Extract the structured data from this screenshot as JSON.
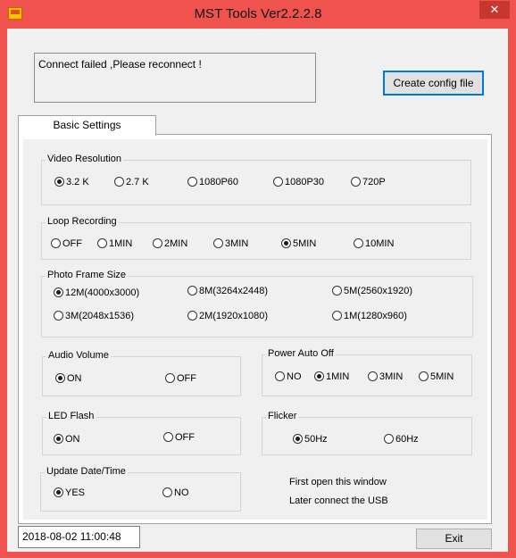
{
  "window": {
    "title": "MST Tools Ver2.2.2.8",
    "close_glyph": "✕"
  },
  "status_message": "Connect failed ,Please reconnect !",
  "create_config_label": "Create config file",
  "tab_label": "Basic Settings",
  "video_resolution": {
    "legend": "Video Resolution",
    "options": [
      "3.2 K",
      "2.7 K",
      "1080P60",
      "1080P30",
      "720P"
    ],
    "selected": "3.2 K"
  },
  "loop_recording": {
    "legend": "Loop Recording",
    "options": [
      "OFF",
      "1MIN",
      "2MIN",
      "3MIN",
      "5MIN",
      "10MIN"
    ],
    "selected": "5MIN"
  },
  "photo_frame_size": {
    "legend": "Photo Frame Size",
    "options": [
      "12M(4000x3000)",
      "8M(3264x2448)",
      "5M(2560x1920)",
      "3M(2048x1536)",
      "2M(1920x1080)",
      "1M(1280x960)"
    ],
    "selected": "12M(4000x3000)"
  },
  "audio_volume": {
    "legend": "Audio Volume",
    "options": [
      "ON",
      "OFF"
    ],
    "selected": "ON"
  },
  "power_auto_off": {
    "legend": "Power Auto Off",
    "options": [
      "NO",
      "1MIN",
      "3MIN",
      "5MIN"
    ],
    "selected": "1MIN"
  },
  "led_flash": {
    "legend": "LED Flash",
    "options": [
      "ON",
      "OFF"
    ],
    "selected": "ON"
  },
  "flicker": {
    "legend": "Flicker",
    "options": [
      "50Hz",
      "60Hz"
    ],
    "selected": "50Hz"
  },
  "update_date_time": {
    "legend": "Update Date/Time",
    "options": [
      "YES",
      "NO"
    ],
    "selected": "YES"
  },
  "instructions": [
    "First open this window",
    "Later connect the USB"
  ],
  "datetime": "2018-08-02 11:00:48",
  "exit_label": "Exit"
}
